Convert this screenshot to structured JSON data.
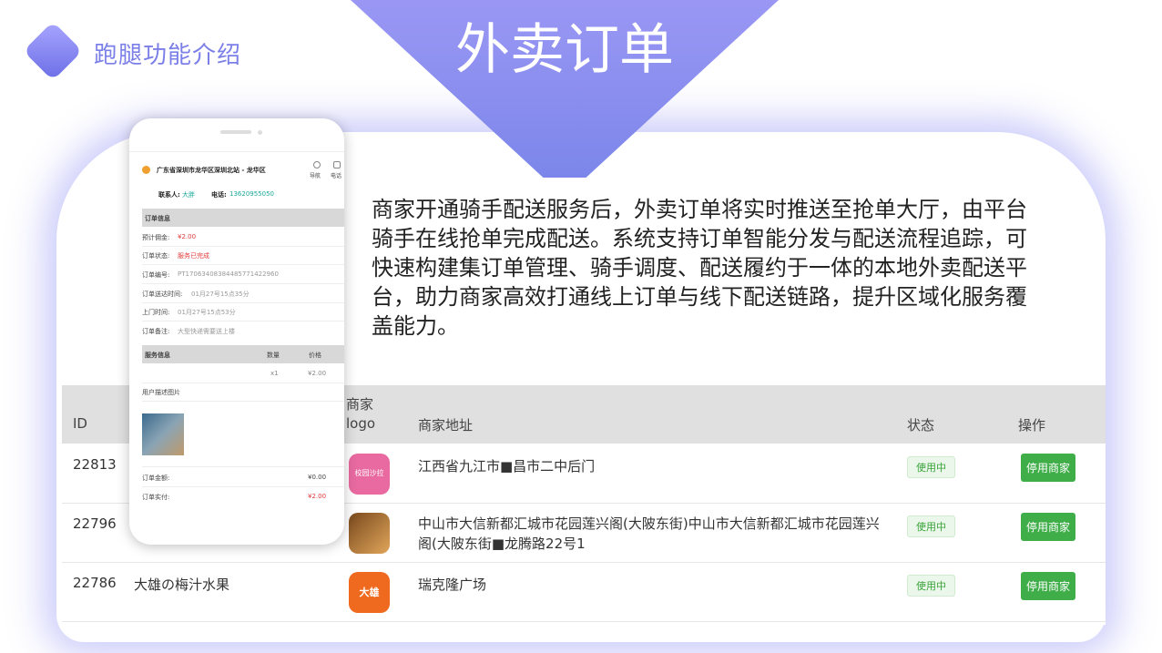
{
  "header": {
    "section_title": "跑腿功能介绍",
    "banner_title": "外卖订单"
  },
  "description": "商家开通骑手配送服务后，外卖订单将实时推送至抢单大厅，由平台骑手在线抢单完成配送。系统支持订单智能分发与配送流程追踪，可快速构建集订单管理、骑手调度、配送履约于一体的本地外卖配送平台，助力商家高效打通线上订单与线下配送链路，提升区域化服务覆盖能力。",
  "table": {
    "headers": {
      "id": "ID",
      "logo_line1": "商家",
      "logo_line2": "logo",
      "address": "商家地址",
      "status": "状态",
      "action": "操作"
    },
    "rows": [
      {
        "id": "22813",
        "name": "",
        "logo_color": "#e86aa0",
        "logo_text": "校园沙拉",
        "address": "江西省九江市■昌市二中后门",
        "status": "使用中",
        "action": "停用商家"
      },
      {
        "id": "22796",
        "name": "",
        "logo_color": "#c9843a",
        "logo_text": "",
        "address": "中山市大信新都汇城市花园莲兴阁(大陂东街)中山市大信新都汇城市花园莲兴阁(大陂东街■龙腾路22号1",
        "status": "使用中",
        "action": "停用商家"
      },
      {
        "id": "22786",
        "name": "大雄の梅汁水果",
        "logo_color": "#ef6a1f",
        "logo_text": "大雄",
        "address": "瑞克隆广场",
        "status": "使用中",
        "action": "停用商家"
      }
    ]
  },
  "phone": {
    "address": "广东省深圳市龙华区深圳北站 - 龙华区",
    "nav_label": "导航",
    "call_label": "电话",
    "contact_label": "联系人:",
    "contact_name": "大胖",
    "phone_label": "电话:",
    "phone_number": "13620955050",
    "order_section": "订单信息",
    "fields": [
      {
        "label": "预计佣金:",
        "value": "¥2.00",
        "highlight": true
      },
      {
        "label": "订单状态:",
        "value": "服务已完成",
        "highlight": true
      },
      {
        "label": "订单编号:",
        "value": "PT17063408384485771422960",
        "highlight": false
      },
      {
        "label": "订单送达时间:",
        "value": "01月27号15点35分",
        "highlight": false
      },
      {
        "label": "上门时间:",
        "value": "01月27号15点53分",
        "highlight": false
      },
      {
        "label": "订单备注:",
        "value": "大型快递需要送上楼",
        "highlight": false
      }
    ],
    "service_section": "服务信息",
    "qty_header": "数量",
    "price_header": "价格",
    "qty": "x1",
    "price": "¥2.00",
    "photo_label": "用户描述图片",
    "total_label": "订单金额:",
    "total_value": "¥0.00",
    "paid_label": "订单实付:",
    "paid_value": "¥2.00"
  },
  "colors": {
    "accent": "#7b7fe8",
    "highlight": "#e03c3c",
    "teal": "#1aa89a",
    "button_green": "#3fae49"
  }
}
